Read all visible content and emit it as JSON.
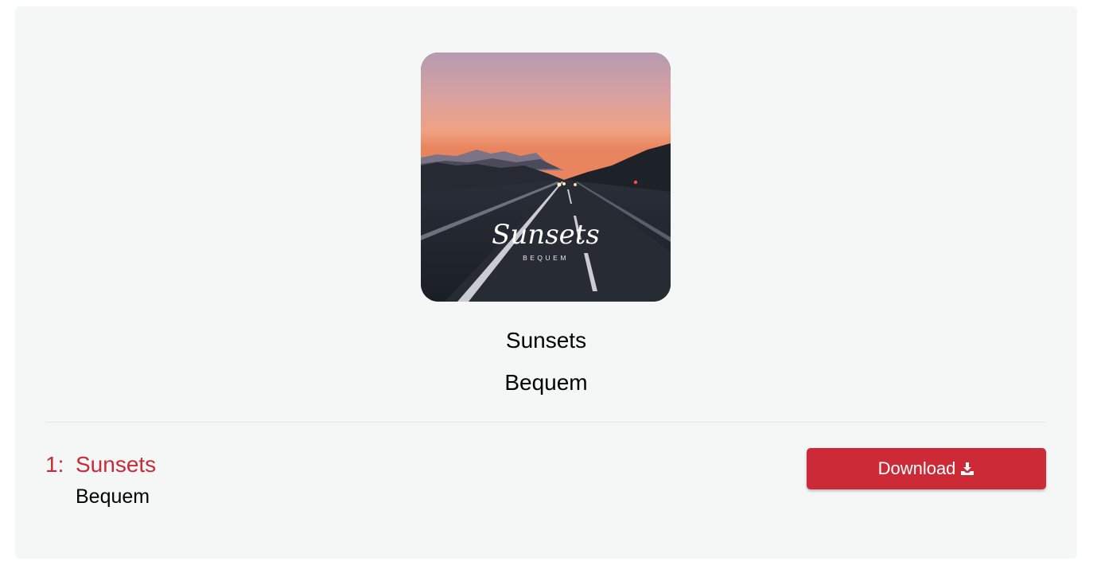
{
  "album": {
    "cover_script_title": "Sunsets",
    "cover_caption": "BEQUEM",
    "title": "Sunsets",
    "artist": "Bequem"
  },
  "tracks": [
    {
      "number": "1:",
      "title": "Sunsets",
      "artist": "Bequem",
      "download_label": "Download"
    }
  ],
  "colors": {
    "accent": "#cc2a37",
    "card_background": "#f4f7f6"
  },
  "icons": {
    "download": "download-icon"
  }
}
